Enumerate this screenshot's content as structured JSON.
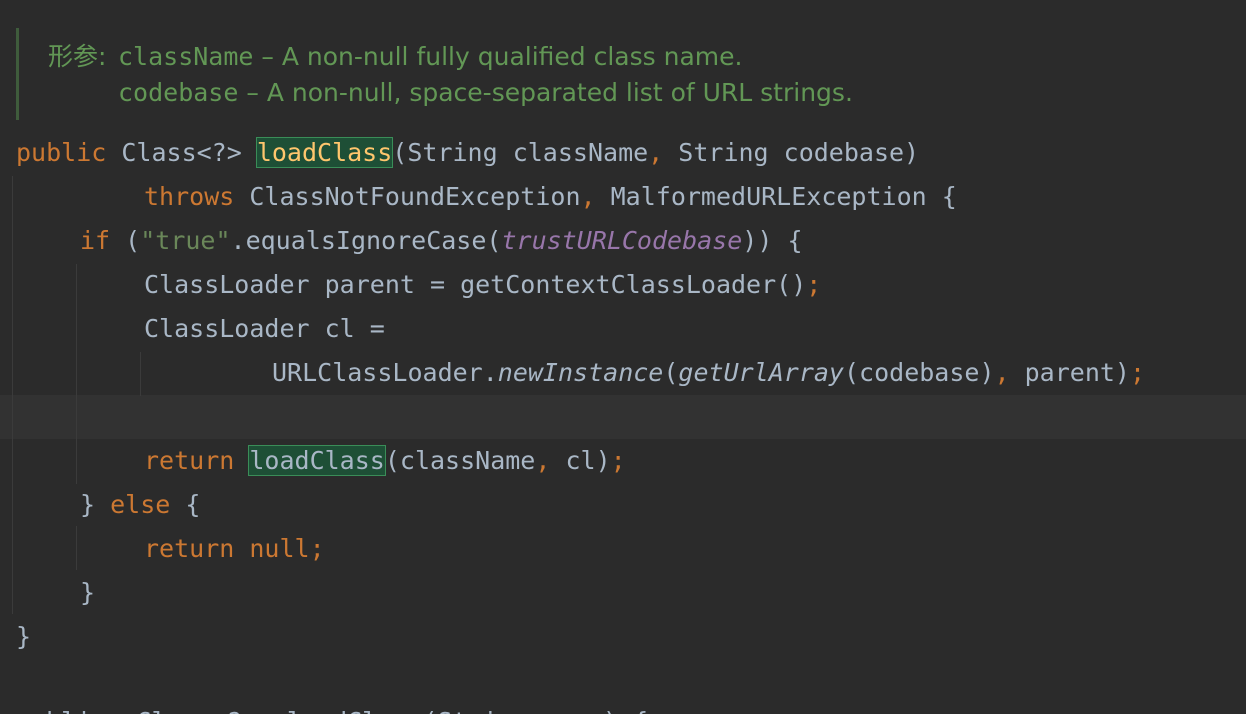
{
  "javadoc": {
    "params_label": "形参:",
    "param1_name": "className",
    "param1_desc": " – A non-null fully qualified class name.",
    "param2_name": "codebase",
    "param2_desc": " – A non-null, space-separated list of URL strings."
  },
  "code": {
    "l1": {
      "kw": "public",
      "ret": " Class<?> ",
      "method": "loadClass",
      "params": "(String className",
      "comma": ",",
      "params2": " String codebase)"
    },
    "l2": {
      "kw": "throws",
      "ex1": " ClassNotFoundException",
      "comma": ",",
      "ex2": " MalformedURLException {"
    },
    "l3": {
      "kw": "if",
      "open": " (",
      "str": "\"true\"",
      "call": ".equalsIgnoreCase(",
      "field": "trustURLCodebase",
      "close": ")) {"
    },
    "l4": {
      "text": "ClassLoader parent = getContextClassLoader()",
      "semi": ";"
    },
    "l5": {
      "text": "ClassLoader cl ="
    },
    "l6": {
      "cls": "URLClassLoader.",
      "m1": "newInstance",
      "open": "(",
      "m2": "getUrlArray",
      "args": "(codebase)",
      "comma": ",",
      "rest": " parent)",
      "semi": ";"
    },
    "l8": {
      "kw": "return",
      "method": "loadClass",
      "args": "(className",
      "comma": ",",
      "rest": " cl)",
      "semi": ";"
    },
    "l9": {
      "brace": "} ",
      "kw": "else",
      "rest": " {"
    },
    "l10": {
      "kw": "return null",
      "semi": ";"
    },
    "l11": {
      "brace": "}"
    },
    "l12": {
      "brace": "}"
    },
    "l14_partial": "public  Class<?>  loadClass(String name) {"
  },
  "colors": {
    "background": "#2b2b2b",
    "keyword": "#cc7832",
    "string": "#6a8759",
    "field": "#9876aa",
    "method_highlight": "#ffc66d",
    "doc": "#629755"
  }
}
